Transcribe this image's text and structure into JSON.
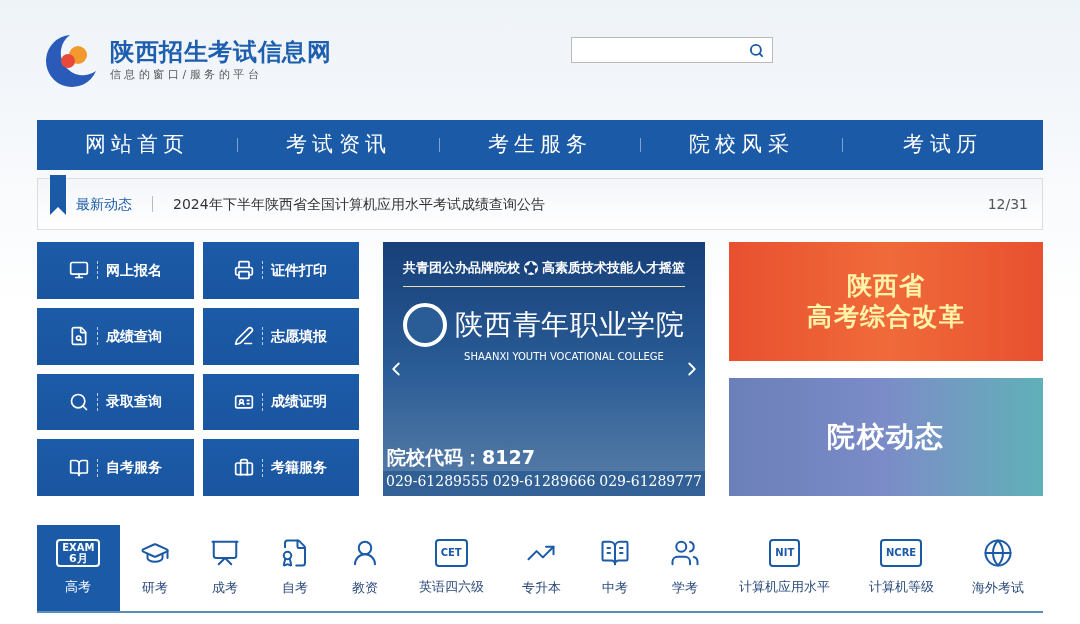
{
  "site": {
    "title": "陕西招生考试信息网",
    "slogan": "信 息 的 窗 口 / 服 务 的 平 台"
  },
  "nav": [
    "网站首页",
    "考试资讯",
    "考生服务",
    "院校风采",
    "考试历"
  ],
  "ticker": {
    "label": "最新动态",
    "headline": "2024年下半年陕西省全国计算机应用水平考试成绩查询公告",
    "date": "12/31"
  },
  "quick_links": [
    "网上报名",
    "证件打印",
    "成绩查询",
    "志愿填报",
    "录取查询",
    "成绩证明",
    "自考服务",
    "考籍服务"
  ],
  "ad": {
    "slogan_left": "共青团公办品牌院校",
    "slogan_right": "高素质技术技能人才摇篮",
    "name": "陕西青年职业学院",
    "english": "SHAANXI YOUTH VOCATIONAL COLLEGE",
    "code": "院校代码：8127",
    "phones": [
      "029-61289555",
      "029-61289666",
      "029-61289777"
    ]
  },
  "banners": [
    {
      "lines": [
        "陕西省",
        "高考综合改革"
      ]
    },
    {
      "lines": [
        "院校动态"
      ]
    }
  ],
  "exam_tabs": [
    {
      "label": "高考",
      "selected": true,
      "icon_text": [
        "EXAM",
        "6月"
      ]
    },
    {
      "label": "研考",
      "selected": false
    },
    {
      "label": "成考",
      "selected": false
    },
    {
      "label": "自考",
      "selected": false
    },
    {
      "label": "教资",
      "selected": false
    },
    {
      "label": "英语四六级",
      "selected": false,
      "icon_text": [
        "CET"
      ]
    },
    {
      "label": "专升本",
      "selected": false
    },
    {
      "label": "中考",
      "selected": false
    },
    {
      "label": "学考",
      "selected": false
    },
    {
      "label": "计算机应用水平",
      "selected": false,
      "icon_text": [
        "NIT"
      ]
    },
    {
      "label": "计算机等级",
      "selected": false,
      "icon_text": [
        "NCRE"
      ]
    },
    {
      "label": "海外考试",
      "selected": false
    }
  ]
}
